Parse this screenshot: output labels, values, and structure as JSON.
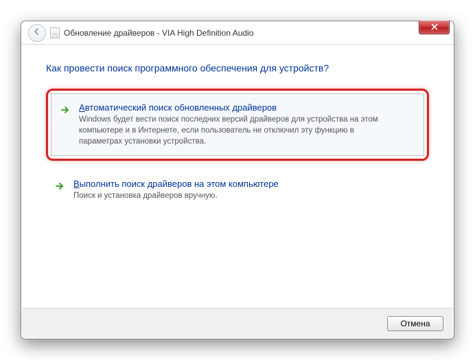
{
  "window": {
    "title": "Обновление драйверов - VIA High Definition Audio"
  },
  "content": {
    "heading": "Как провести поиск программного обеспечения для устройств?",
    "options": [
      {
        "title_prefix": "А",
        "title_rest": "втоматический поиск обновленных драйверов",
        "description": "Windows будет вести поиск последних версий драйверов для устройства на этом компьютере и в Интернете, если пользователь не отключил эту функцию в параметрах установки устройства.",
        "highlighted": true
      },
      {
        "title_prefix": "В",
        "title_rest": "ыполнить поиск драйверов на этом компьютере",
        "description": "Поиск и установка драйверов вручную.",
        "highlighted": false
      }
    ]
  },
  "footer": {
    "cancel_label": "Отмена"
  }
}
